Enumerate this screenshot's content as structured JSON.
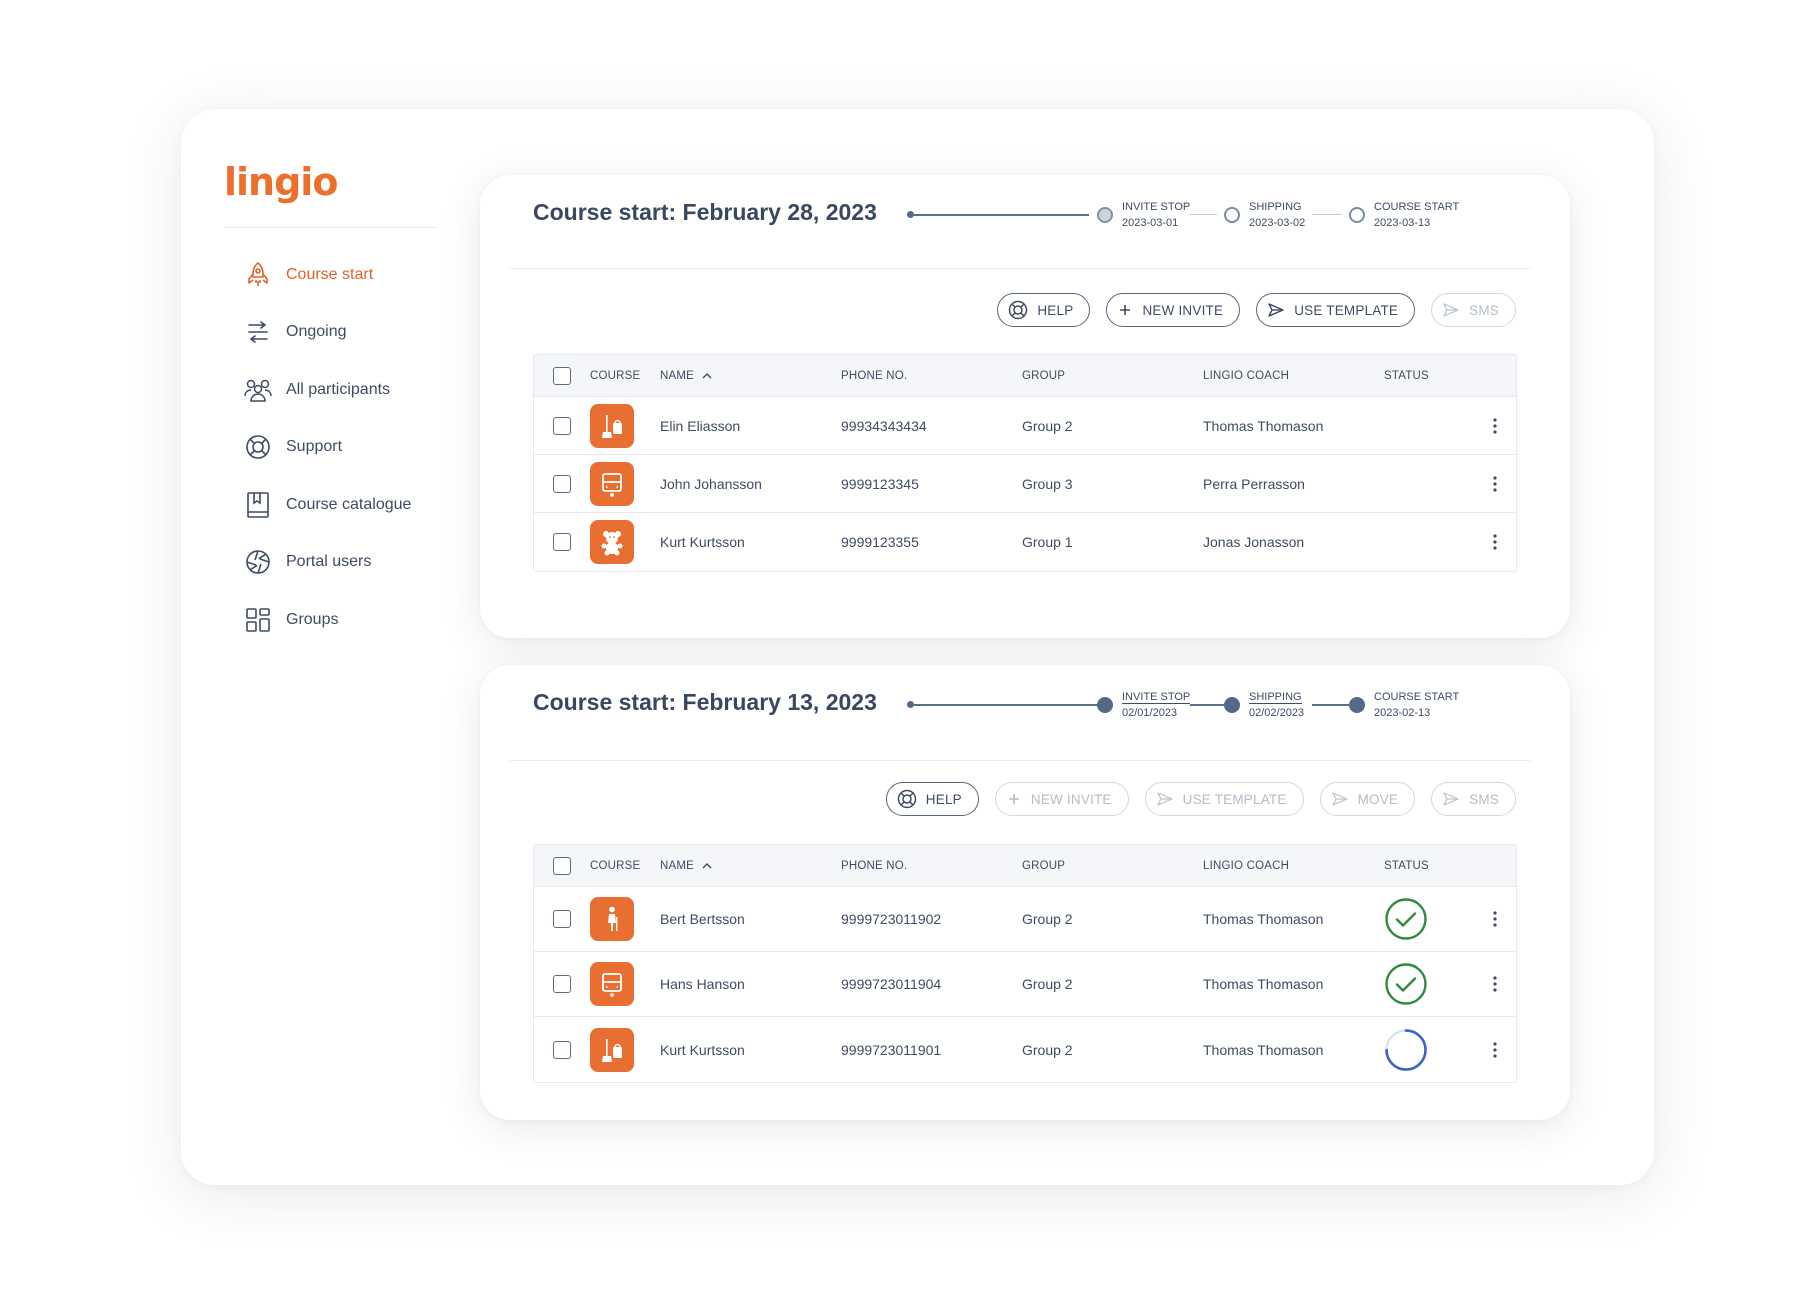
{
  "app": {
    "logo": "lingio"
  },
  "sidebar": {
    "items": [
      {
        "label": "Course start",
        "icon": "rocket-icon",
        "active": true
      },
      {
        "label": "Ongoing",
        "icon": "arrows-icon",
        "active": false
      },
      {
        "label": "All participants",
        "icon": "people-icon",
        "active": false
      },
      {
        "label": "Support",
        "icon": "lifebuoy-icon",
        "active": false
      },
      {
        "label": "Course catalogue",
        "icon": "book-icon",
        "active": false
      },
      {
        "label": "Portal users",
        "icon": "aperture-icon",
        "active": false
      },
      {
        "label": "Groups",
        "icon": "grid-icon",
        "active": false
      }
    ]
  },
  "columns": {
    "course": "COURSE",
    "name": "NAME",
    "phone": "PHONE NO.",
    "group": "GROUP",
    "coach": "LINGIO COACH",
    "status": "STATUS"
  },
  "buttons": {
    "help": "HELP",
    "new_invite": "NEW INVITE",
    "use_template": "USE TEMPLATE",
    "sms": "SMS",
    "move": "MOVE"
  },
  "cards": [
    {
      "title": "Course start: February 28, 2023",
      "timeline": [
        {
          "label": "INVITE STOP",
          "date": "2023-03-01"
        },
        {
          "label": "SHIPPING",
          "date": "2023-03-02"
        },
        {
          "label": "COURSE START",
          "date": "2023-03-13"
        }
      ],
      "rows": [
        {
          "course_icon": "cleaning-icon",
          "name": "Elin Eliasson",
          "phone": "99934343434",
          "group": "Group 2",
          "coach": "Thomas Thomason",
          "status": ""
        },
        {
          "course_icon": "bus-icon",
          "name": "John Johansson",
          "phone": "9999123345",
          "group": "Group 3",
          "coach": "Perra Perrasson",
          "status": ""
        },
        {
          "course_icon": "teddy-bear-icon",
          "name": "Kurt Kurtsson",
          "phone": "9999123355",
          "group": "Group 1",
          "coach": "Jonas Jonasson",
          "status": ""
        }
      ]
    },
    {
      "title": "Course start: February 13, 2023",
      "timeline": [
        {
          "label": "INVITE STOP",
          "date": "02/01/2023"
        },
        {
          "label": "SHIPPING",
          "date": "02/02/2023"
        },
        {
          "label": "COURSE START",
          "date": "2023-02-13"
        }
      ],
      "rows": [
        {
          "course_icon": "caregiver-icon",
          "name": "Bert Bertsson",
          "phone": "9999723011902",
          "group": "Group 2",
          "coach": "Thomas Thomason",
          "status": "complete"
        },
        {
          "course_icon": "bus-icon",
          "name": "Hans Hanson",
          "phone": "9999723011904",
          "group": "Group 2",
          "coach": "Thomas Thomason",
          "status": "complete"
        },
        {
          "course_icon": "cleaning-icon",
          "name": "Kurt Kurtsson",
          "phone": "9999723011901",
          "group": "Group 2",
          "coach": "Thomas Thomason",
          "status": "in-progress"
        }
      ]
    }
  ],
  "colors": {
    "accent": "#E86F31",
    "text": "#3E4B62",
    "success": "#2E8B3E",
    "progress": "#3A64C8"
  }
}
